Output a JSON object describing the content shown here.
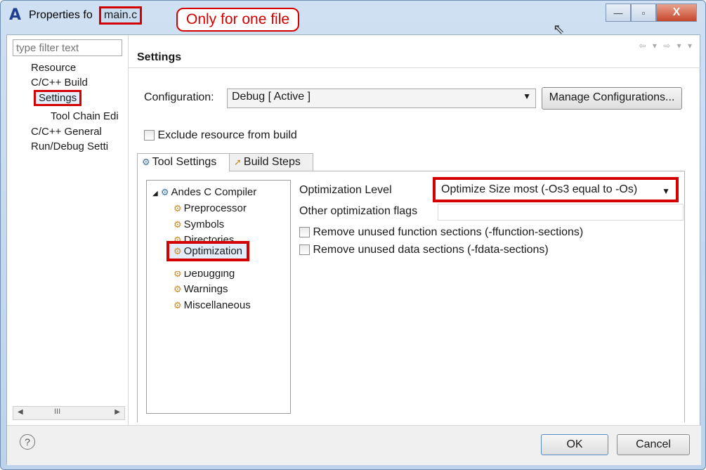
{
  "window": {
    "title_prefix": "Properties fo",
    "title_file": "main.c",
    "minimize": "—",
    "maximize": "▫",
    "close": "X"
  },
  "callout": "Only for one file",
  "left": {
    "filter_placeholder": "type filter text",
    "tree": [
      "Resource",
      "C/C++ Build",
      "Settings",
      "Tool Chain Edi",
      "C/C++ General",
      "Run/Debug Setti"
    ],
    "scroll_mark": "III"
  },
  "page": {
    "title": "Settings"
  },
  "config": {
    "label": "Configuration:",
    "value": "Debug  [ Active ]",
    "manage_button": "Manage Configurations..."
  },
  "exclude": {
    "label": "Exclude resource from build"
  },
  "tabs": [
    {
      "label": "Tool Settings"
    },
    {
      "label": "Build Steps"
    }
  ],
  "inner_tree": {
    "root": "Andes C Compiler",
    "children": [
      "Preprocessor",
      "Symbols",
      "Directories",
      "Optimization",
      "Debugging",
      "Warnings",
      "Miscellaneous"
    ]
  },
  "optimization": {
    "level_label": "Optimization Level",
    "level_value": "Optimize Size most (-Os3 equal to -Os)",
    "flags_label": "Other optimization flags",
    "flags_value": "",
    "opt1": "Remove unused function sections (-ffunction-sections)",
    "opt2": "Remove unused data sections (-fdata-sections)"
  },
  "buttons": {
    "ok": "OK",
    "cancel": "Cancel",
    "help": "?"
  },
  "accent": "#d40000"
}
